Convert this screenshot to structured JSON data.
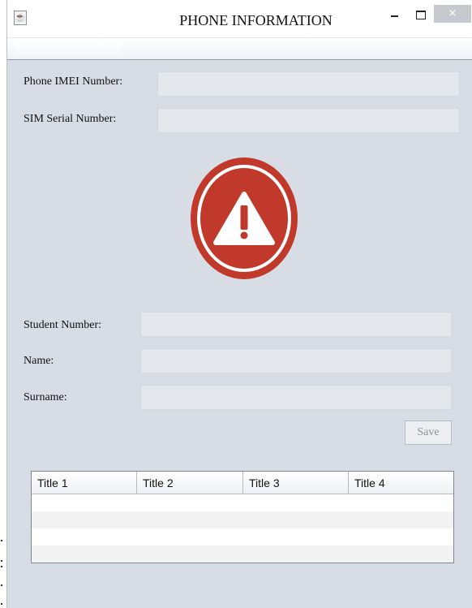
{
  "window": {
    "title": "PHONE INFORMATION",
    "close_glyph": "×"
  },
  "form": {
    "imei_label": "Phone IMEI Number:",
    "imei_value": "",
    "sim_label": "SIM Serial Number:",
    "sim_value": "",
    "student_label": "Student Number:",
    "student_value": "",
    "name_label": "Name:",
    "name_value": "",
    "surname_label": "Surname:",
    "surname_value": ""
  },
  "warning": {
    "icon": "warning-icon",
    "color": "#c0392b"
  },
  "save_label": "Save",
  "table": {
    "headers": [
      "Title 1",
      "Title 2",
      "Title 3",
      "Title 4"
    ],
    "rows": [
      [
        "",
        "",
        "",
        ""
      ],
      [
        "",
        "",
        "",
        ""
      ],
      [
        "",
        "",
        "",
        ""
      ],
      [
        "",
        "",
        "",
        ""
      ]
    ]
  }
}
